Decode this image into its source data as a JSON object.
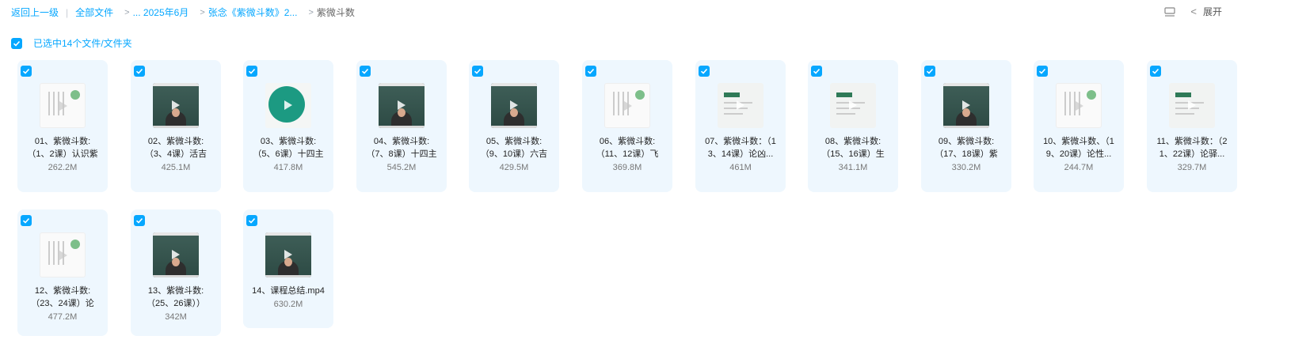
{
  "breadcrumb": {
    "back": "返回上一级",
    "all_files": "全部文件",
    "path1": "... 2025年6月",
    "path2": "张念《紫微斗数》2...",
    "current": "紫微斗数"
  },
  "tools": {
    "expand_label": "展开",
    "view_icon": "list-icon",
    "chevron_icon": "chevron-left-icon"
  },
  "selection": {
    "label": "已选中14个文件/文件夹"
  },
  "colors": {
    "accent": "#06a7ff",
    "card_bg": "#eef7fe"
  },
  "files": [
    {
      "line1": "01、紫微斗数:",
      "line2": "（1、2课）认识紫",
      "size": "262.2M",
      "thumb": "doc"
    },
    {
      "line1": "02、紫微斗数:",
      "line2": "（3、4课）活吉",
      "size": "425.1M",
      "thumb": "video"
    },
    {
      "line1": "03、紫微斗数:",
      "line2": "（5、6课）十四主",
      "size": "417.8M",
      "thumb": "circle"
    },
    {
      "line1": "04、紫微斗数:",
      "line2": "（7、8课）十四主",
      "size": "545.2M",
      "thumb": "video"
    },
    {
      "line1": "05、紫微斗数:",
      "line2": "（9、10课）六吉",
      "size": "429.5M",
      "thumb": "video"
    },
    {
      "line1": "06、紫微斗数:",
      "line2": "（11、12课）飞",
      "size": "369.8M",
      "thumb": "doc"
    },
    {
      "line1": "07、紫微斗数：（1",
      "line2": "3、14课）论凶...",
      "size": "461M",
      "thumb": "slide"
    },
    {
      "line1": "08、紫微斗数:",
      "line2": "（15、16课）生",
      "size": "341.1M",
      "thumb": "slide"
    },
    {
      "line1": "09、紫微斗数:",
      "line2": "（17、18课）紫",
      "size": "330.2M",
      "thumb": "video"
    },
    {
      "line1": "10、紫微斗数、（1",
      "line2": "9、20课）论性...",
      "size": "244.7M",
      "thumb": "doc"
    },
    {
      "line1": "11、紫微斗数：（2",
      "line2": "1、22课）论驿...",
      "size": "329.7M",
      "thumb": "slide"
    },
    {
      "line1": "12、紫微斗数:",
      "line2": "（23、24课）论",
      "size": "477.2M",
      "thumb": "doc"
    },
    {
      "line1": "13、紫微斗数:",
      "line2": "（25、26课））",
      "size": "342M",
      "thumb": "video"
    },
    {
      "line1": "14、课程总结.mp4",
      "line2": "",
      "size": "630.2M",
      "thumb": "video"
    }
  ]
}
